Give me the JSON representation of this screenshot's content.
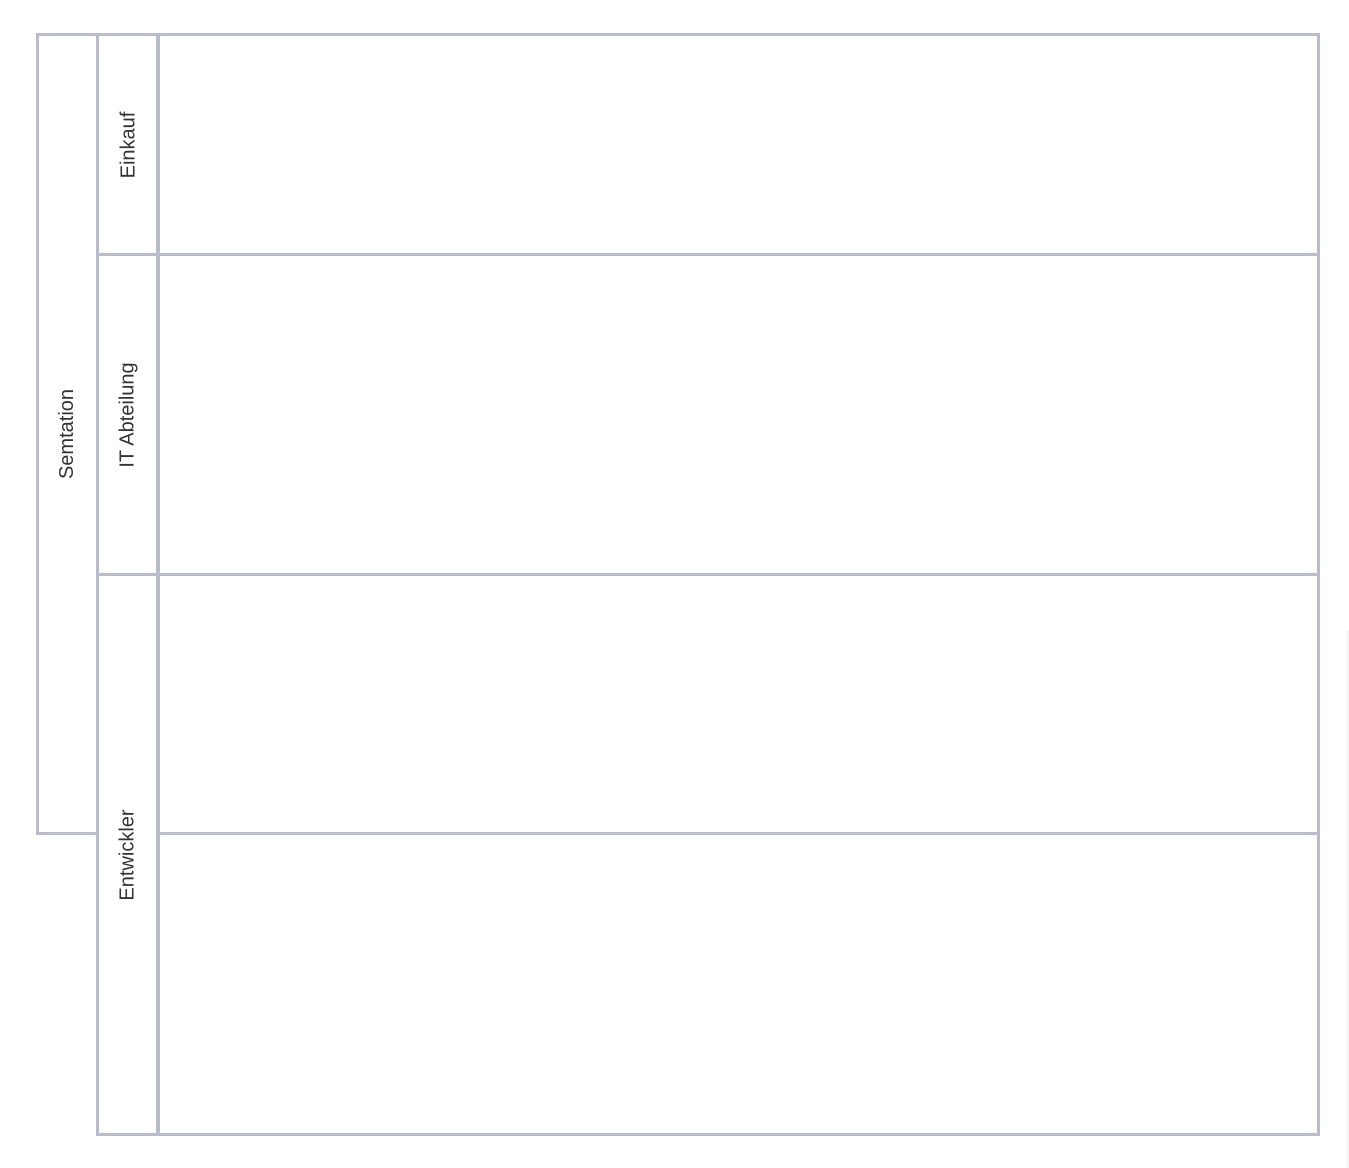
{
  "colors": {
    "border": "#b8bccb",
    "text": "#333333",
    "background": "#ffffff"
  },
  "pool": {
    "label": "Semtation"
  },
  "lanes": [
    {
      "label": "Einkauf"
    },
    {
      "label": "IT Abteilung"
    },
    {
      "label": "Entwickler"
    }
  ]
}
